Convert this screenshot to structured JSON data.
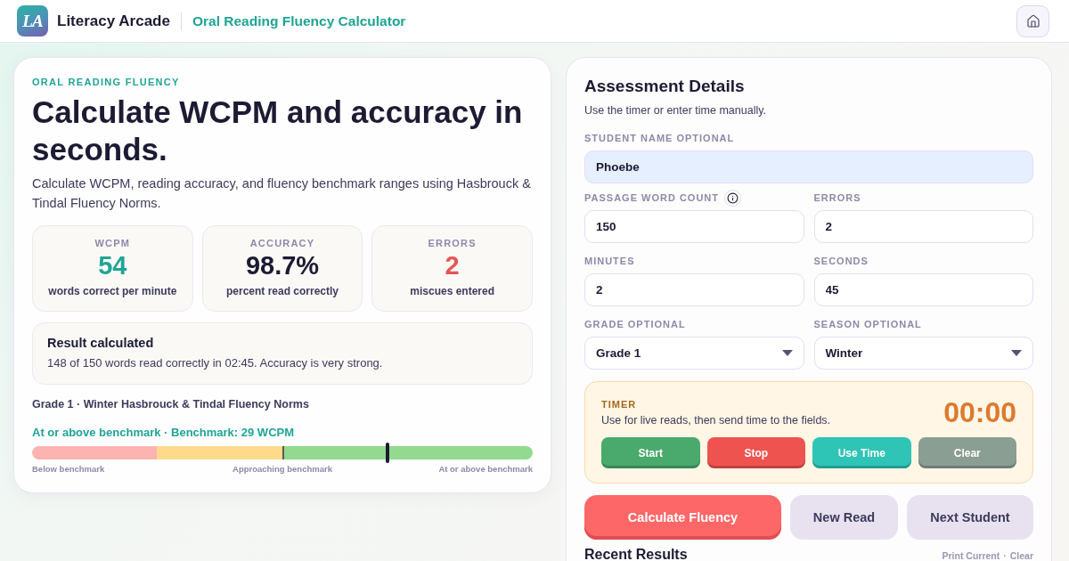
{
  "header": {
    "logo_text": "LA",
    "brand": "Literacy Arcade",
    "page_title": "Oral Reading Fluency Calculator"
  },
  "intro": {
    "eyebrow": "ORAL READING FLUENCY",
    "heading": "Calculate WCPM and accuracy in seconds.",
    "description": "Calculate WCPM, reading accuracy, and fluency benchmark ranges using Hasbrouck & Tindal Fluency Norms."
  },
  "stats": [
    {
      "label": "WCPM",
      "value": "54",
      "caption": "words correct per minute",
      "kind": "good"
    },
    {
      "label": "ACCURACY",
      "value": "98.7%",
      "caption": "percent read correctly",
      "kind": "plain"
    },
    {
      "label": "ERRORS",
      "value": "2",
      "caption": "miscues entered",
      "kind": "bad"
    }
  ],
  "result": {
    "title": "Result calculated",
    "message": "148 of 150 words read correctly in 02:45. Accuracy is very strong."
  },
  "benchmark": {
    "norms": "Grade 1 · Winter Hasbrouck & Tindal Fluency Norms",
    "status": "At or above benchmark · Benchmark: 29 WCPM",
    "level": 0.71,
    "zones": [
      "Below benchmark",
      "Approaching benchmark",
      "At or above benchmark"
    ]
  },
  "assessment": {
    "title": "Assessment Details",
    "subtitle": "Use the timer or enter time manually.",
    "student_name": {
      "label": "STUDENT NAME OPTIONAL",
      "value": "Phoebe",
      "autofilled": true
    },
    "fields": [
      {
        "label": "PASSAGE WORD COUNT",
        "value": "150",
        "kind": "input",
        "info": true
      },
      {
        "label": "ERRORS",
        "value": "2",
        "kind": "input",
        "info": false
      },
      {
        "label": "MINUTES",
        "value": "2",
        "kind": "input",
        "info": false
      },
      {
        "label": "SECONDS",
        "value": "45",
        "kind": "input",
        "info": false
      },
      {
        "label": "GRADE OPTIONAL",
        "value": "Grade 1",
        "kind": "select",
        "info": false
      },
      {
        "label": "SEASON OPTIONAL",
        "value": "Winter",
        "kind": "select",
        "info": false
      }
    ]
  },
  "timer": {
    "label": "TIMER",
    "hint": "Use for live reads, then send time to the fields.",
    "time": "00:00",
    "buttons": [
      {
        "label": "Start",
        "color": "#4aa96c"
      },
      {
        "label": "Stop",
        "color": "#ef5350"
      },
      {
        "label": "Use Time",
        "color": "#2ec4b6"
      },
      {
        "label": "Clear",
        "color": "#8a9e94"
      }
    ]
  },
  "actions": [
    {
      "label": "Calculate Fluency",
      "kind": "primary"
    },
    {
      "label": "New Read",
      "kind": "secondary"
    },
    {
      "label": "Next Student",
      "kind": "secondary"
    }
  ],
  "recent": {
    "title": "Recent Results",
    "links": [
      "Print Current",
      "Clear"
    ],
    "separator": "·"
  }
}
